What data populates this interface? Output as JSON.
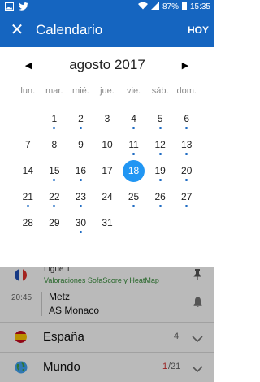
{
  "status_bar": {
    "battery": "87%",
    "time": "15:35"
  },
  "app_bar": {
    "close_icon": "close-icon",
    "title": "Calendario",
    "today_label": "HOY"
  },
  "calendar": {
    "month_label": "agosto 2017",
    "weekdays": [
      "lun.",
      "mar.",
      "mié.",
      "jue.",
      "vie.",
      "sáb.",
      "dom."
    ],
    "leading_empty": 1,
    "days": [
      {
        "n": "1",
        "dot": true
      },
      {
        "n": "2",
        "dot": true
      },
      {
        "n": "3",
        "dot": false
      },
      {
        "n": "4",
        "dot": true
      },
      {
        "n": "5",
        "dot": true
      },
      {
        "n": "6",
        "dot": true
      },
      {
        "n": "7",
        "dot": false
      },
      {
        "n": "8",
        "dot": false
      },
      {
        "n": "9",
        "dot": false
      },
      {
        "n": "10",
        "dot": false
      },
      {
        "n": "11",
        "dot": true
      },
      {
        "n": "12",
        "dot": true
      },
      {
        "n": "13",
        "dot": true
      },
      {
        "n": "14",
        "dot": false
      },
      {
        "n": "15",
        "dot": true
      },
      {
        "n": "16",
        "dot": true
      },
      {
        "n": "17",
        "dot": false
      },
      {
        "n": "18",
        "dot": false,
        "selected": true
      },
      {
        "n": "19",
        "dot": true
      },
      {
        "n": "20",
        "dot": true
      },
      {
        "n": "21",
        "dot": true
      },
      {
        "n": "22",
        "dot": true
      },
      {
        "n": "23",
        "dot": true
      },
      {
        "n": "24",
        "dot": false
      },
      {
        "n": "25",
        "dot": true
      },
      {
        "n": "26",
        "dot": true
      },
      {
        "n": "27",
        "dot": true
      },
      {
        "n": "28",
        "dot": false
      },
      {
        "n": "29",
        "dot": false
      },
      {
        "n": "30",
        "dot": true
      },
      {
        "n": "31",
        "dot": false
      }
    ]
  },
  "background": {
    "league": "Ligue 1",
    "league_link": "Valoraciones SofaScore y HeatMap",
    "match_time": "20:45",
    "home_team": "Metz",
    "away_team": "AS Monaco",
    "espana_label": "España",
    "espana_count": "4",
    "mundo_label": "Mundo",
    "mundo_count_live": "1",
    "mundo_count_total": "/21"
  },
  "colors": {
    "primary": "#1565c0",
    "accent": "#2196f3",
    "link_green": "#388e3c",
    "live_red": "#d32f2f"
  }
}
